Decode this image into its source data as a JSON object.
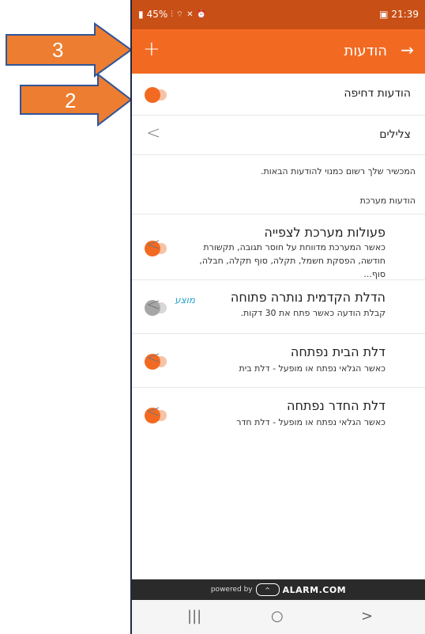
{
  "status_bar": {
    "battery": "45%",
    "time": "21:39"
  },
  "app_bar": {
    "title": "הודעות",
    "add_label": "+",
    "back_label": "→"
  },
  "vibrate_row": {
    "label": "הודעות דחיפה",
    "toggle_on": true
  },
  "sounds_row": {
    "label": "צלילים",
    "chevron": "<"
  },
  "device_note": "המכשיר שלך רשום כמנוי להודעות הבאות.",
  "section_header": "הודעות מערכת",
  "notifications": [
    {
      "title": "פעולות מערכת לצפייה",
      "description": "כאשר המערכת מדווחת על חוסר תגובה, תקשורת חודשה, הפסקת חשמל, תקלה, סוף תקלה, חבלה, סוף...",
      "enabled": true,
      "badge": ""
    },
    {
      "title": "הדלת הקדמית נותרה פתוחה",
      "description": "קבלת הודעה כאשר פתח את 30 דקות.",
      "enabled": false,
      "badge": "מוצע"
    },
    {
      "title": "דלת הבית נפתחה",
      "description": "כאשר הגלאי נפתח או מופעל - דלת בית",
      "enabled": true,
      "badge": ""
    },
    {
      "title": "דלת החדר נפתחה",
      "description": "כאשר הגלאי נפתח או מופעל - דלת חדר",
      "enabled": true,
      "badge": ""
    }
  ],
  "footer": {
    "powered_by": "powered by",
    "brand": "ALARM.COM"
  },
  "nav_bar": {
    "recents": "|||",
    "home": "○",
    "back": ">"
  },
  "annotations": {
    "arrow_3": "3",
    "arrow_2": "2"
  },
  "colors": {
    "accent": "#f26a22",
    "status_bar": "#c84f16",
    "annotation_arrow": "#ed7d31",
    "badge": "#2aa3c9"
  }
}
